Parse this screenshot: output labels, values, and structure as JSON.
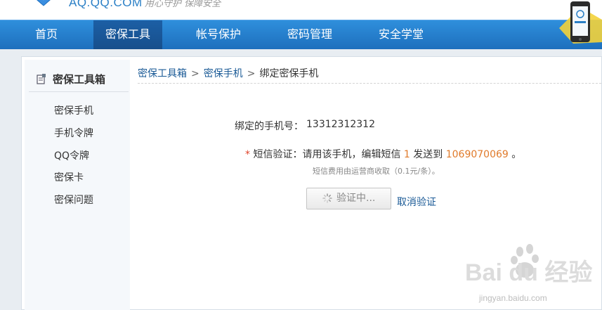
{
  "header": {
    "logo_text": "AQ.QQ.COM",
    "slogan": "用心守护 保障安全"
  },
  "nav": {
    "items": [
      {
        "label": "首页"
      },
      {
        "label": "密保工具"
      },
      {
        "label": "帐号保护"
      },
      {
        "label": "密码管理"
      },
      {
        "label": "安全学堂"
      }
    ],
    "active_index": 1
  },
  "sidebar": {
    "title": "密保工具箱",
    "items": [
      {
        "label": "密保手机"
      },
      {
        "label": "手机令牌"
      },
      {
        "label": "QQ令牌"
      },
      {
        "label": "密保卡"
      },
      {
        "label": "密保问题"
      }
    ]
  },
  "breadcrumb": {
    "items": [
      "密保工具箱",
      "密保手机",
      "绑定密保手机"
    ],
    "separator": ">"
  },
  "form": {
    "phone_label": "绑定的手机号：",
    "phone_value": "13312312312",
    "required_mark": "*",
    "sms_label": "短信验证：",
    "sms_text_1": "请用该手机，编辑短信",
    "sms_code": "1",
    "sms_text_2": "发送到",
    "sms_number": "1069070069",
    "sms_end": "。",
    "fee_note": "短信费用由运营商收取（0.1元/条）。",
    "verify_button": "验证中...",
    "cancel_link": "取消验证"
  },
  "watermark": {
    "brand": "Bai du 经验",
    "url": "jingyan.baidu.com"
  },
  "colors": {
    "nav_bg": "#1d6fbd",
    "nav_active": "#174f8c",
    "link": "#1a5a96",
    "highlight": "#e07a2a",
    "required": "#e0432a"
  }
}
